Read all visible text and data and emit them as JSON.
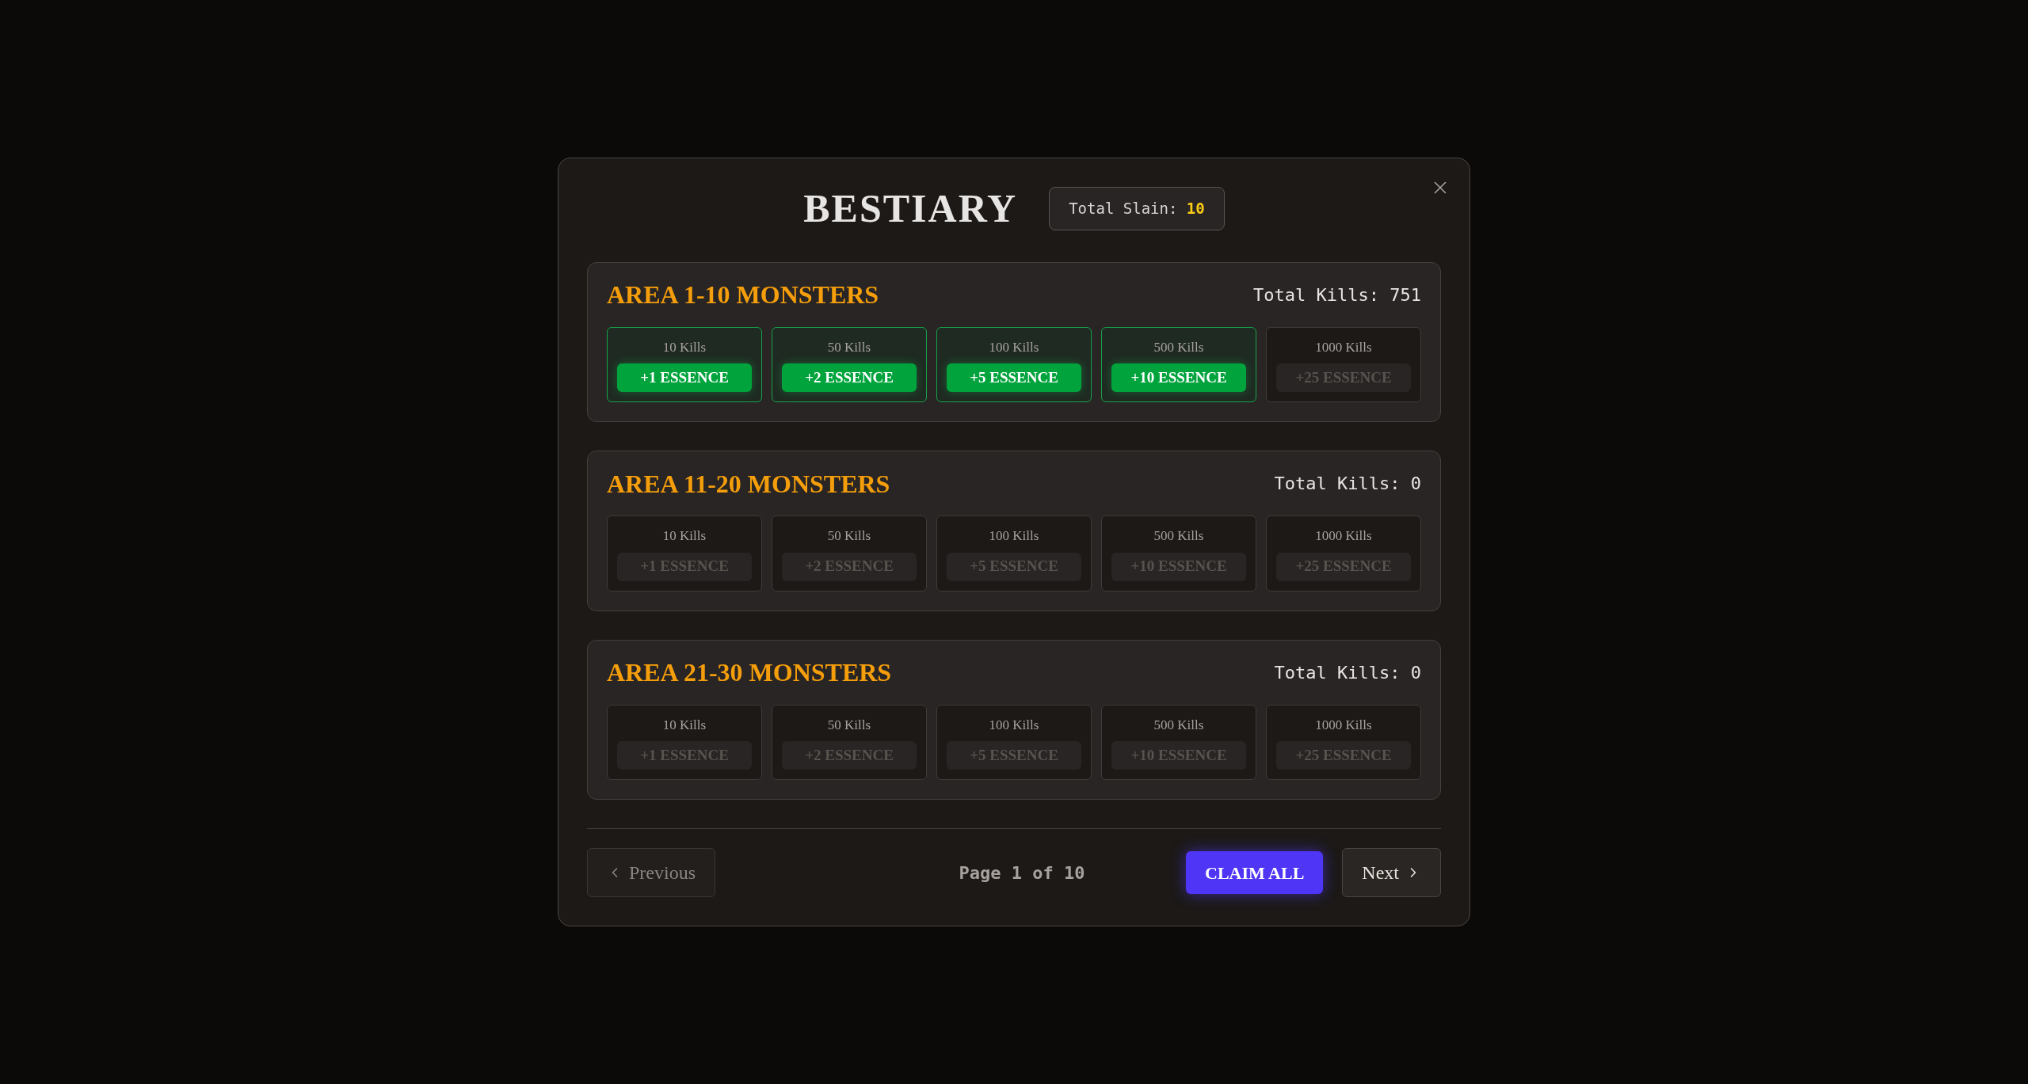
{
  "dialog": {
    "title": "BESTIARY",
    "slain_label": "Total Slain:",
    "slain_value": "10"
  },
  "areas": [
    {
      "name": "AREA 1-10 MONSTERS",
      "kills": "Total Kills: 751",
      "milestones": [
        {
          "label": "10 Kills",
          "reward": "+1 ESSENCE",
          "claimable": true
        },
        {
          "label": "50 Kills",
          "reward": "+2 ESSENCE",
          "claimable": true
        },
        {
          "label": "100 Kills",
          "reward": "+5 ESSENCE",
          "claimable": true
        },
        {
          "label": "500 Kills",
          "reward": "+10 ESSENCE",
          "claimable": true
        },
        {
          "label": "1000 Kills",
          "reward": "+25 ESSENCE",
          "claimable": false
        }
      ]
    },
    {
      "name": "AREA 11-20 MONSTERS",
      "kills": "Total Kills: 0",
      "milestones": [
        {
          "label": "10 Kills",
          "reward": "+1 ESSENCE",
          "claimable": false
        },
        {
          "label": "50 Kills",
          "reward": "+2 ESSENCE",
          "claimable": false
        },
        {
          "label": "100 Kills",
          "reward": "+5 ESSENCE",
          "claimable": false
        },
        {
          "label": "500 Kills",
          "reward": "+10 ESSENCE",
          "claimable": false
        },
        {
          "label": "1000 Kills",
          "reward": "+25 ESSENCE",
          "claimable": false
        }
      ]
    },
    {
      "name": "AREA 21-30 MONSTERS",
      "kills": "Total Kills: 0",
      "milestones": [
        {
          "label": "10 Kills",
          "reward": "+1 ESSENCE",
          "claimable": false
        },
        {
          "label": "50 Kills",
          "reward": "+2 ESSENCE",
          "claimable": false
        },
        {
          "label": "100 Kills",
          "reward": "+5 ESSENCE",
          "claimable": false
        },
        {
          "label": "500 Kills",
          "reward": "+10 ESSENCE",
          "claimable": false
        },
        {
          "label": "1000 Kills",
          "reward": "+25 ESSENCE",
          "claimable": false
        }
      ]
    }
  ],
  "footer": {
    "previous": {
      "label": "Previous",
      "disabled": true
    },
    "page": "Page 1 of 10",
    "claim_all": "CLAIM ALL",
    "next": {
      "label": "Next",
      "disabled": false
    }
  }
}
